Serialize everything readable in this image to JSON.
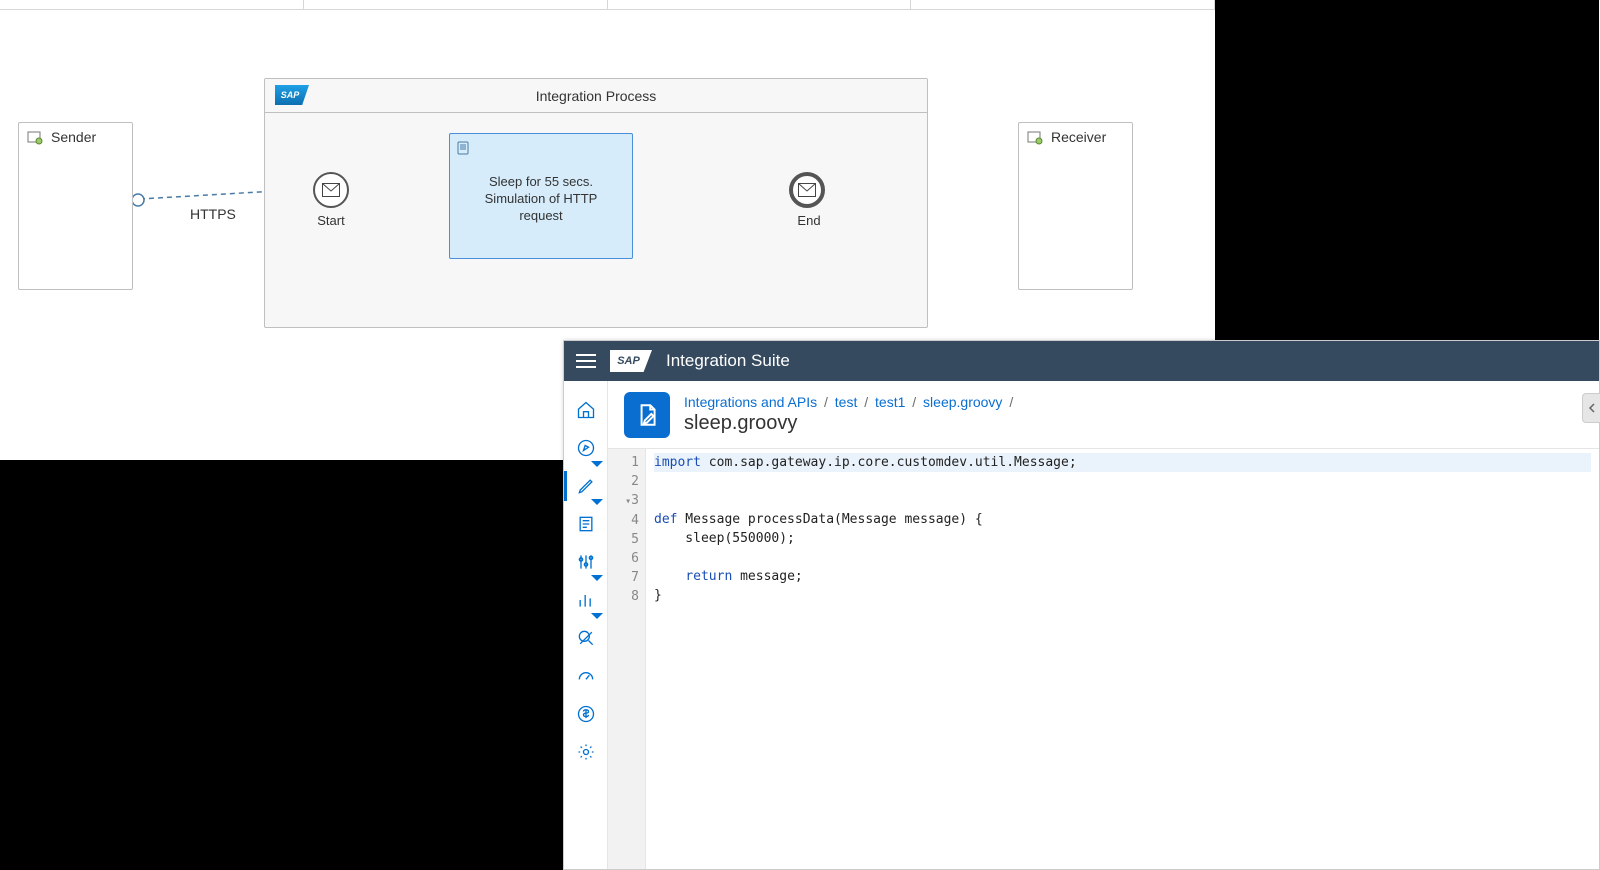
{
  "diagram": {
    "pool_title": "Integration Process",
    "sap_logo_text": "SAP",
    "sender_label": "Sender",
    "receiver_label": "Receiver",
    "connector_label": "HTTPS",
    "start_label": "Start",
    "end_label": "End",
    "script_task_line1": "Sleep for 55 secs.",
    "script_task_line2": "Simulation of HTTP",
    "script_task_line3": "request"
  },
  "suite": {
    "app_title": "Integration Suite",
    "sap_logo_text": "SAP",
    "breadcrumb": {
      "root": "Integrations and APIs",
      "seg1": "test",
      "seg2": "test1",
      "seg3": "sleep.groovy"
    },
    "file_heading": "sleep.groovy",
    "code": {
      "line1_import": "import",
      "line1_rest": " com.sap.gateway.ip.core.customdev.util.Message;",
      "line3_def": "def",
      "line3_rest": " Message processData(Message message) {",
      "line4": "    sleep(550000);",
      "line6_return": "return",
      "line6_rest": " message;",
      "line7": "}"
    },
    "line_numbers": [
      "1",
      "2",
      "3",
      "4",
      "5",
      "6",
      "7",
      "8"
    ]
  }
}
